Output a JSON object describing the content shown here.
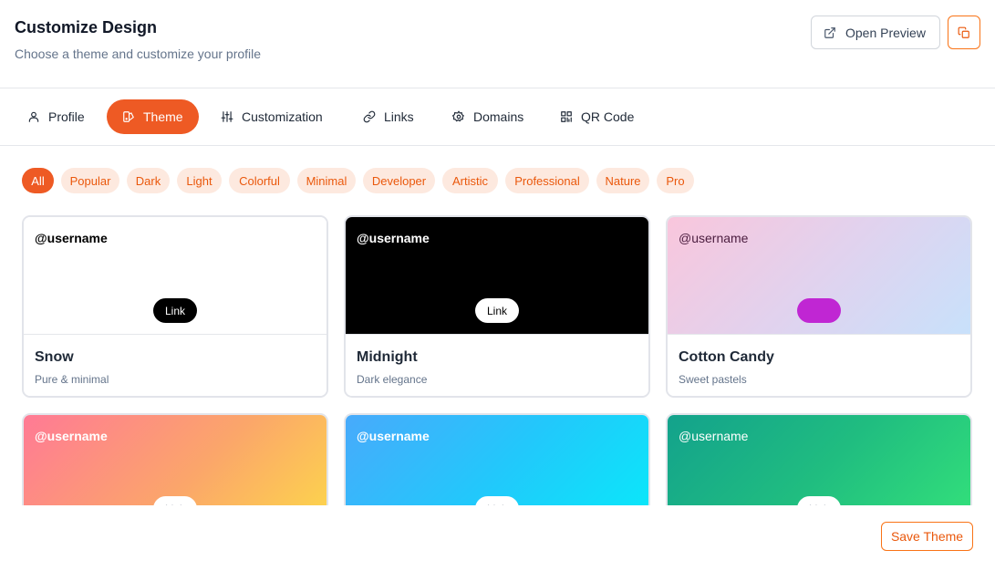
{
  "header": {
    "title": "Customize Design",
    "subtitle": "Choose a theme and customize your profile",
    "open_preview_label": "Open Preview"
  },
  "tabs": [
    {
      "label": "Profile",
      "icon": "user-icon",
      "active": false
    },
    {
      "label": "Theme",
      "icon": "palette-icon",
      "active": true
    },
    {
      "label": "Customization",
      "icon": "sliders-icon",
      "active": false
    },
    {
      "label": "Links",
      "icon": "link-icon",
      "active": false
    },
    {
      "label": "Domains",
      "icon": "gear-icon",
      "active": false
    },
    {
      "label": "QR Code",
      "icon": "qr-code-icon",
      "active": false
    }
  ],
  "filters": [
    {
      "label": "All",
      "active": true
    },
    {
      "label": "Popular"
    },
    {
      "label": "Dark"
    },
    {
      "label": "Light"
    },
    {
      "label": "Colorful"
    },
    {
      "label": "Minimal"
    },
    {
      "label": "Developer"
    },
    {
      "label": "Artistic"
    },
    {
      "label": "Professional"
    },
    {
      "label": "Nature"
    },
    {
      "label": "Pro"
    }
  ],
  "themes": [
    {
      "username": "@username",
      "link_label": "Link",
      "name": "Snow",
      "description": "Pure & minimal"
    },
    {
      "username": "@username",
      "link_label": "Link",
      "name": "Midnight",
      "description": "Dark elegance"
    },
    {
      "username": "@username",
      "link_label": "",
      "name": "Cotton Candy",
      "description": "Sweet pastels"
    },
    {
      "username": "@username",
      "link_label": "Link",
      "name": "",
      "description": ""
    },
    {
      "username": "@username",
      "link_label": "Link",
      "name": "",
      "description": ""
    },
    {
      "username": "@username",
      "link_label": "Link",
      "name": "",
      "description": ""
    }
  ],
  "save_label": "Save Theme",
  "colors": {
    "accent": "#ee5a24",
    "chip_bg": "#fde9df",
    "chip_text": "#ea580c",
    "snow": "#ffffff",
    "midnight": "#000000",
    "cotton_candy_pill": "#c026d3"
  }
}
